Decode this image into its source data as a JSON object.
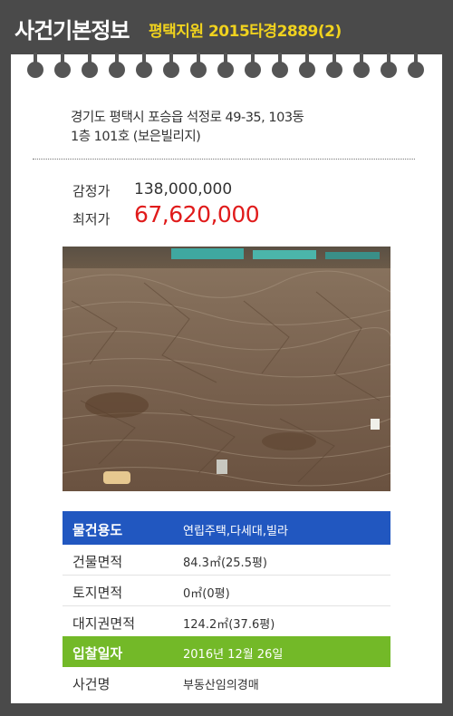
{
  "header": {
    "title": "사건기본정보",
    "case": "평택지원 2015타경2889(2)"
  },
  "address": {
    "line1": "경기도 평택시 포승읍 석정로 49-35, 103동",
    "line2": "1층 101호 (보은빌리지)"
  },
  "prices": {
    "appraisal_label": "감정가",
    "appraisal_value": "138,000,000",
    "minimum_label": "최저가",
    "minimum_value": "67,620,000"
  },
  "photo": {
    "icon": "property-photo"
  },
  "info_rows": [
    {
      "label": "물건용도",
      "value": "연립주택,다세대,빌라"
    },
    {
      "label": "건물면적",
      "value": "84.3㎡(25.5평)"
    },
    {
      "label": "토지면적",
      "value": "0㎡(0평)"
    },
    {
      "label": "대지권면적",
      "value": "124.2㎡(37.6평)"
    },
    {
      "label": "입찰일자",
      "value": "2016년 12월 26일"
    },
    {
      "label": "사건명",
      "value": "부동산임의경매"
    }
  ],
  "colors": {
    "background": "#4a4a4a",
    "case_accent": "#f0d21e",
    "minimum_price": "#e01b1b",
    "usage_row": "#2157c0",
    "bid_date_row": "#73b928"
  }
}
